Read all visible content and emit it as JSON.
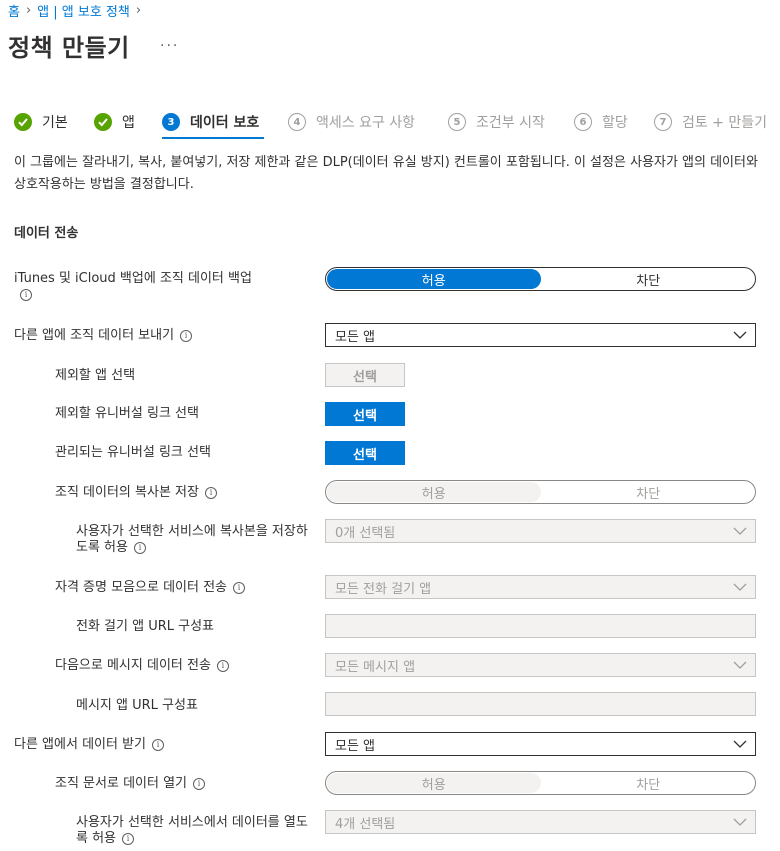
{
  "breadcrumb": {
    "home": "홈",
    "parent": "앱 | 앱 보호 정책"
  },
  "page": {
    "title": "정책 만들기",
    "more": "..."
  },
  "steps": [
    {
      "number": "1",
      "label": "기본",
      "state": "done"
    },
    {
      "number": "2",
      "label": "앱",
      "state": "done"
    },
    {
      "number": "3",
      "label": "데이터 보호",
      "state": "current"
    },
    {
      "number": "4",
      "label": "액세스 요구 사항",
      "state": "future"
    },
    {
      "number": "5",
      "label": "조건부 시작",
      "state": "future"
    },
    {
      "number": "6",
      "label": "할당",
      "state": "future"
    },
    {
      "number": "7",
      "label": "검토 + 만들기",
      "state": "future"
    }
  ],
  "description": "이 그룹에는 잘라내기, 복사, 붙여넣기, 저장 제한과 같은 DLP(데이터 유실 방지) 컨트롤이 포함됩니다. 이 설정은 사용자가 앱의 데이터와 상호작용하는 방법을 결정합니다.",
  "section": {
    "title": "데이터 전송"
  },
  "settings": {
    "itunes_backup": {
      "label": "iTunes 및 iCloud 백업에 조직 데이터 백업",
      "options": [
        "허용",
        "차단"
      ],
      "selected": "허용"
    },
    "send_data": {
      "label": "다른 앱에 조직 데이터 보내기",
      "value": "모든 앱"
    },
    "exempt_apps": {
      "label": "제외할 앱 선택",
      "button": "선택"
    },
    "exempt_universal_links": {
      "label": "제외할 유니버설 링크 선택",
      "button": "선택"
    },
    "managed_universal_links": {
      "label": "관리되는 유니버설 링크 선택",
      "button": "선택"
    },
    "save_copies": {
      "label": "조직 데이터의 복사본 저장",
      "options": [
        "허용",
        "차단"
      ],
      "selected": "허용"
    },
    "save_services": {
      "label": "사용자가 선택한 서비스에 복사본을 저장하도록 허용",
      "value": "0개 선택됨"
    },
    "telecom_transfer": {
      "label": "자격 증명 모음으로 데이터 전송",
      "value": "모든 전화 걸기 앱"
    },
    "dialer_url": {
      "label": "전화 걸기 앱 URL 구성표",
      "value": ""
    },
    "message_transfer": {
      "label": "다음으로 메시지 데이터 전송",
      "value": "모든 메시지 앱"
    },
    "messaging_url": {
      "label": "메시지 앱 URL 구성표",
      "value": ""
    },
    "receive_data": {
      "label": "다른 앱에서 데이터 받기",
      "value": "모든 앱"
    },
    "open_into_org_docs": {
      "label": "조직 문서로 데이터 열기",
      "options": [
        "허용",
        "차단"
      ],
      "selected": "허용"
    },
    "open_services": {
      "label": "사용자가 선택한 서비스에서 데이터를 열도록 허용",
      "value": "4개 선택됨"
    }
  },
  "colors": {
    "accent": "#0078d4",
    "done": "#57a300",
    "disabled_bg": "#f3f2f1",
    "disabled_text": "#a19f9d"
  }
}
